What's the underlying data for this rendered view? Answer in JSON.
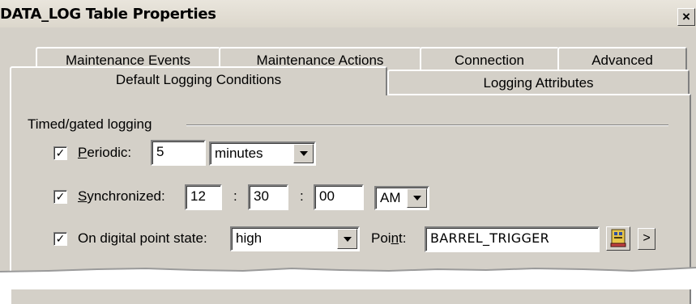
{
  "window": {
    "title": "DATA_LOG Table Properties",
    "close_label": "×"
  },
  "tabs_back_row": [
    {
      "label": "Maintenance Events"
    },
    {
      "label": "Maintenance Actions"
    },
    {
      "label": "Connection"
    },
    {
      "label": "Advanced"
    }
  ],
  "tabs_front_row": [
    {
      "label": "Default Logging Conditions",
      "active": true
    },
    {
      "label": "Logging Attributes",
      "active": false
    }
  ],
  "group": {
    "title": "Timed/gated logging"
  },
  "periodic": {
    "checked": true,
    "check_glyph": "✓",
    "label_prefix": "P",
    "label_rest": "eriodic:",
    "value": "5",
    "unit": "minutes"
  },
  "synchronized": {
    "checked": true,
    "check_glyph": "✓",
    "label_prefix": "S",
    "label_rest": "ynchronized:",
    "hours": "12",
    "minutes": "30",
    "seconds": "00",
    "separator": ":",
    "ampm": "AM"
  },
  "digital_state": {
    "checked": true,
    "check_glyph": "✓",
    "label": "On digital point state:",
    "state": "high",
    "point_label_a": "Poi",
    "point_label_b": "n",
    "point_label_c": "t:",
    "point_value": "BARREL_TRIGGER",
    "next_label": ">"
  }
}
